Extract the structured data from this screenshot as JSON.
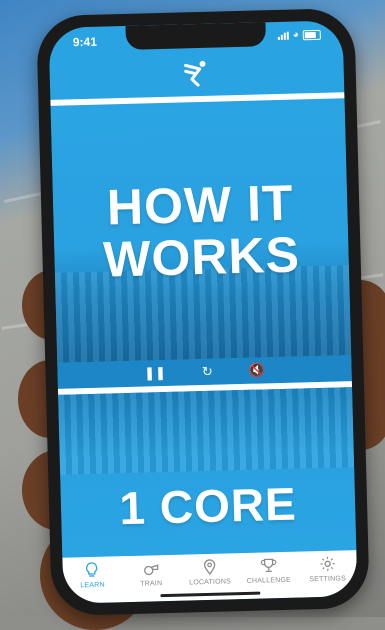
{
  "status_bar": {
    "time": "9:41"
  },
  "video_top": {
    "headline_line1": "HOW IT",
    "headline_line2": "WORKS"
  },
  "video_bottom": {
    "title": "1 CORE"
  },
  "controls": {
    "pause_icon": "pause-icon",
    "replay_icon": "replay-icon",
    "mute_icon": "mute-icon"
  },
  "tabbar": {
    "items": [
      {
        "label": "LEARN",
        "icon": "lightbulb-icon",
        "active": true
      },
      {
        "label": "TRAIN",
        "icon": "whistle-icon",
        "active": false
      },
      {
        "label": "LOCATIONS",
        "icon": "location-pin-icon",
        "active": false
      },
      {
        "label": "CHALLENGE",
        "icon": "trophy-icon",
        "active": false
      },
      {
        "label": "SETTINGS",
        "icon": "gear-icon",
        "active": false
      }
    ]
  },
  "colors": {
    "brand": "#2aa3e2",
    "inactive": "#8a8a8a"
  }
}
